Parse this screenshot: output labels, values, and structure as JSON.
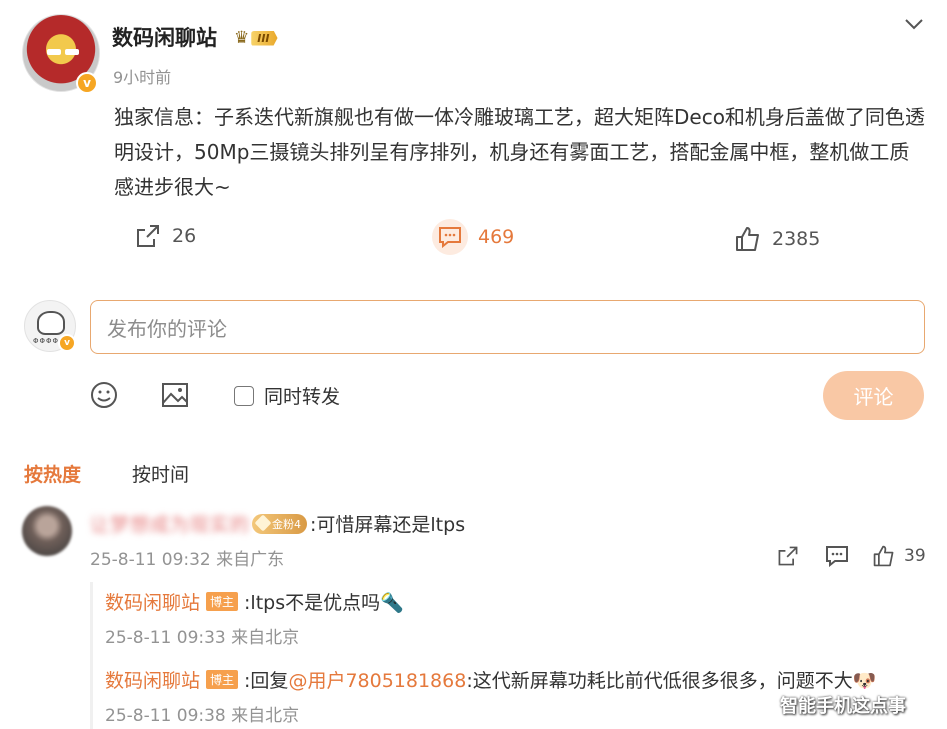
{
  "post": {
    "username": "数码闲聊站",
    "level_badge": "III",
    "verify_mark": "v",
    "time": "9小时前",
    "content": "独家信息：子系迭代新旗舰也有做一体冷雕玻璃工艺，超大矩阵Deco和机身后盖做了同色透明设计，50Mp三摄镜头排列呈有序排列，机身还有雾面工艺，搭配金属中框，整机做工质感进步很大~",
    "reposts": "26",
    "comments": "469",
    "likes": "2385"
  },
  "composer": {
    "placeholder": "发布你的评论",
    "repost_label": "同时转发",
    "submit_label": "评论",
    "avatar_text": "ΦΦΦΦΦ"
  },
  "sort": {
    "hot_label": "按热度",
    "time_label": "按时间"
  },
  "comments": [
    {
      "user_blurred": "让梦想成为现实的",
      "fan_badge": "金粉4",
      "text": ":可惜屏幕还是ltps",
      "meta": "25-8-11 09:32 来自广东",
      "likes": "39",
      "replies": [
        {
          "user": "数码闲聊站",
          "tag": "博主",
          "text": ":ltps不是优点吗",
          "emoji": "🔦",
          "meta": "25-8-11 09:33 来自北京"
        },
        {
          "user": "数码闲聊站",
          "tag": "博主",
          "reply_prefix": ":回复",
          "mention": "@用户7805181868",
          "text": ":这代新屏幕功耗比前代低很多很多，问题不大",
          "emoji": "🐶",
          "meta": "25-8-11 09:38 来自北京"
        }
      ]
    }
  ],
  "watermark": "智能手机这点事",
  "colors": {
    "accent": "#e5793c",
    "verify": "#f6a623",
    "submit_disabled": "#f9c8a5",
    "muted_text": "#939393"
  },
  "icons": [
    "chevron-down-icon",
    "repost-icon",
    "comment-icon",
    "like-icon",
    "emoji-icon",
    "image-icon",
    "crown-icon"
  ]
}
